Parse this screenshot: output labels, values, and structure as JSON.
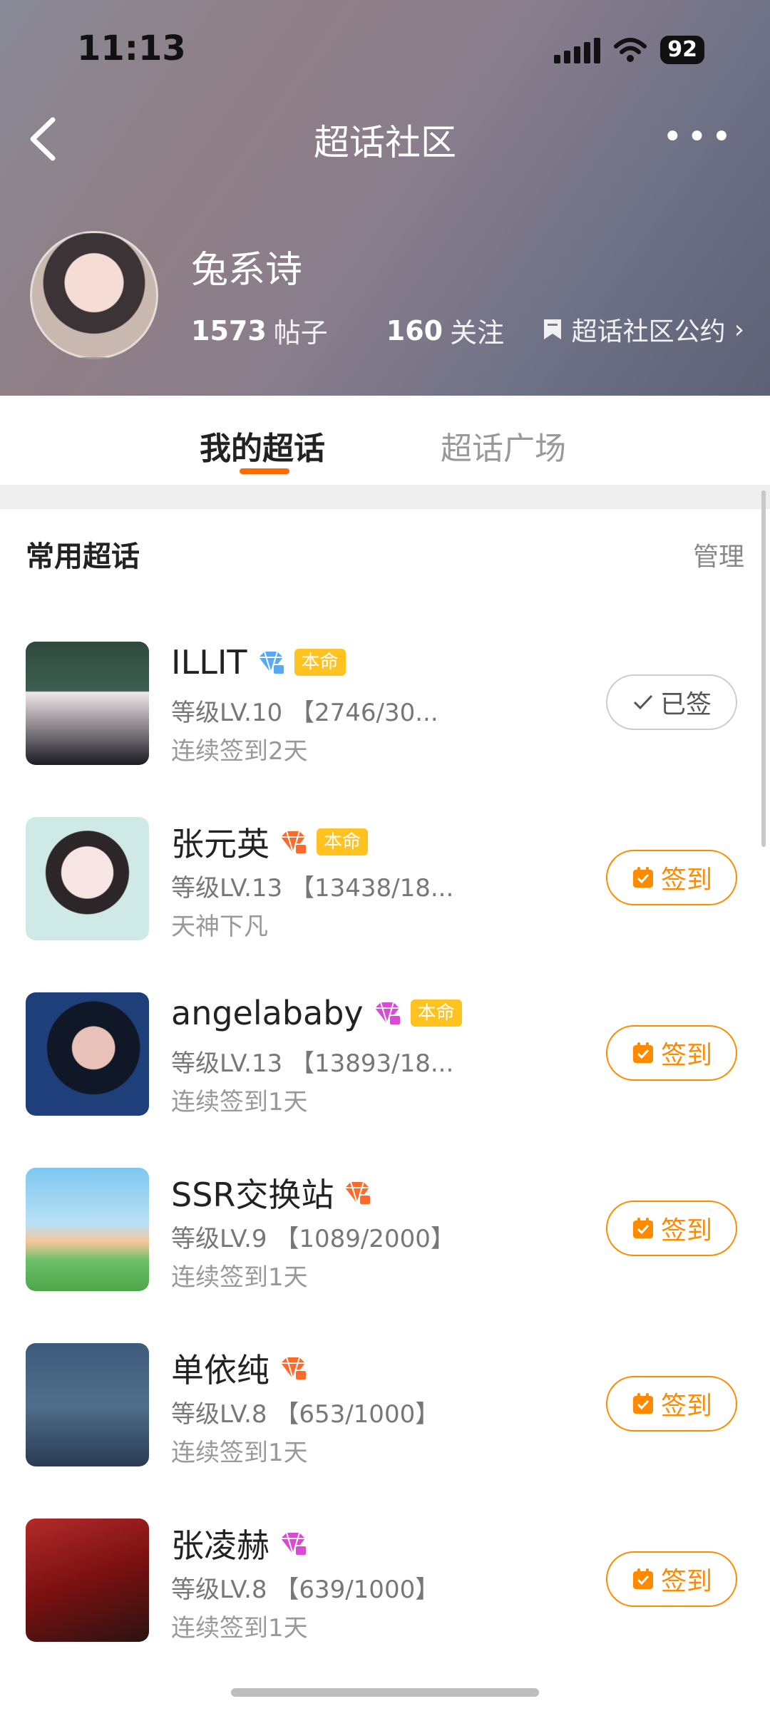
{
  "status": {
    "time": "11:13",
    "battery": "92"
  },
  "nav": {
    "title": "超话社区",
    "more": "•••"
  },
  "profile": {
    "name": "兔系诗",
    "posts_num": "1573",
    "posts_label": "帖子",
    "follow_num": "160",
    "follow_label": "关注",
    "convention": "超话社区公约"
  },
  "tabs": [
    "我的超话",
    "超话广场"
  ],
  "section": {
    "title": "常用超话",
    "manage": "管理"
  },
  "rows": [
    {
      "name": "ILLIT",
      "badge": "本命",
      "level": "等级LV.10 【2746/30...",
      "sub": "连续签到2天",
      "button": "已签",
      "signed": true,
      "gem_color": "#5aa8f5"
    },
    {
      "name": "张元英",
      "badge": "本命",
      "level": "等级LV.13 【13438/18...",
      "sub": "天神下凡",
      "button": "签到",
      "signed": false,
      "gem_color": "#ff6a2a"
    },
    {
      "name": "angelababy",
      "badge": "本命",
      "level": "等级LV.13 【13893/18...",
      "sub": "连续签到1天",
      "button": "签到",
      "signed": false,
      "gem_color": "#d94ad6"
    },
    {
      "name": "SSR交换站",
      "badge": "",
      "level": "等级LV.9 【1089/2000】",
      "sub": "连续签到1天",
      "button": "签到",
      "signed": false,
      "gem_color": "#ff6a2a"
    },
    {
      "name": "单依纯",
      "badge": "",
      "level": "等级LV.8 【653/1000】",
      "sub": "连续签到1天",
      "button": "签到",
      "signed": false,
      "gem_color": "#ff6a2a"
    },
    {
      "name": "张凌赫",
      "badge": "",
      "level": "等级LV.8 【639/1000】",
      "sub": "连续签到1天",
      "button": "签到",
      "signed": false,
      "gem_color": "#d94ad6"
    }
  ]
}
